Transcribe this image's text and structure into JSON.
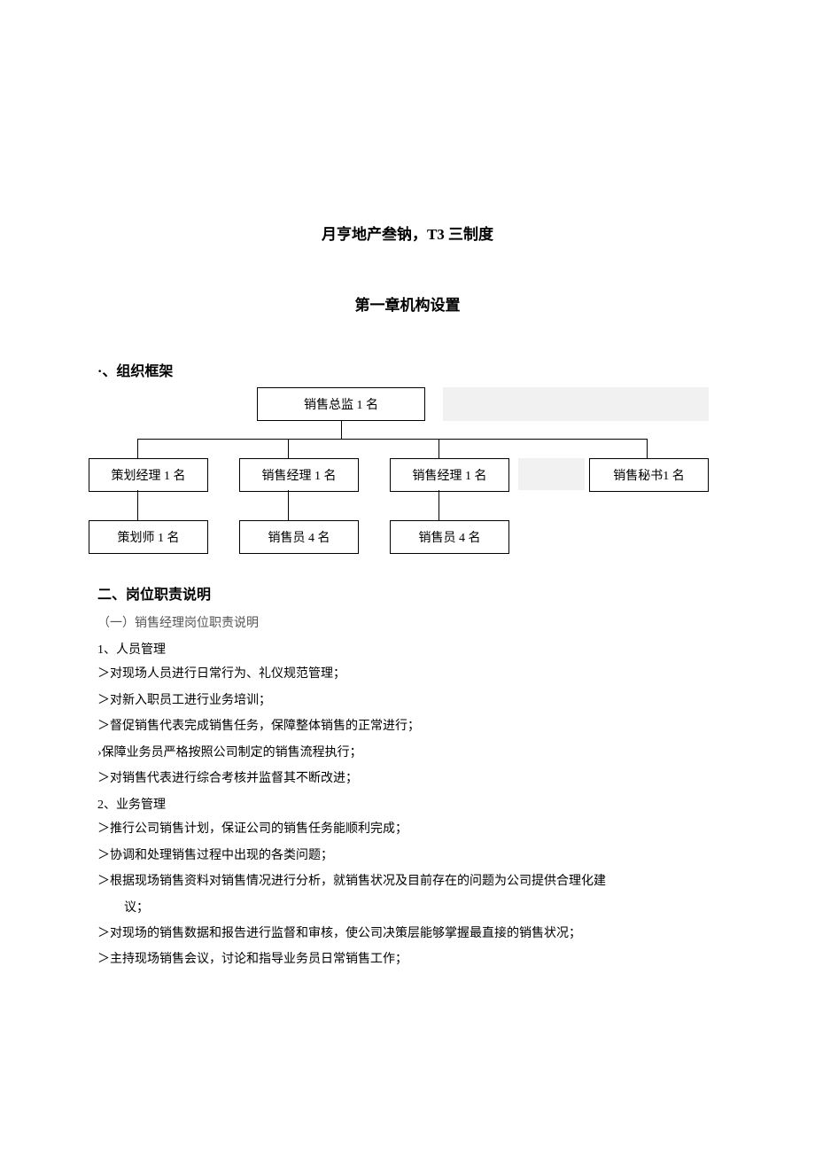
{
  "doc": {
    "title": "月亨地产叁钠，T3 三制度",
    "chapter": "第一章机构设置",
    "section1": "·、组织框架",
    "section2": "二、岗位职责说明",
    "sub1": "（一）销售经理岗位职责说明",
    "p1": "1、人员管理",
    "b1": "＞对现场人员进行日常行为、礼仪规范管理；",
    "b2": "＞对新入职员工进行业务培训；",
    "b3": "＞督促销售代表完成销售任务，保障整体销售的正常进行；",
    "b4": "›保障业务员严格按照公司制定的销售流程执行；",
    "b5": "＞对销售代表进行综合考核并监督其不断改进；",
    "p2": "2、业务管理",
    "b6": "＞推行公司销售计划，保证公司的销售任务能顺利完成；",
    "b7": "＞协调和处理销售过程中出现的各类问题；",
    "b8": "＞根据现场销售资料对销售情况进行分析，就销售状况及目前存在的问题为公司提供合理化建",
    "b8b": "议；",
    "b9": "＞对现场的销售数据和报告进行监督和审核，使公司决策层能够掌握最直接的销售状况；",
    "b10": "＞主持现场销售会议，讨论和指导业务员日常销售工作；"
  },
  "org": {
    "top": "销售总监 1 名",
    "r1c1": "策划经理 1 名",
    "r1c2": "销售经理 1 名",
    "r1c3": "销售经理 1 名",
    "r1c4": "销售秘书1 名",
    "r2c1": "策划师 1 名",
    "r2c2": "销售员 4 名",
    "r2c3": "销售员 4 名"
  }
}
